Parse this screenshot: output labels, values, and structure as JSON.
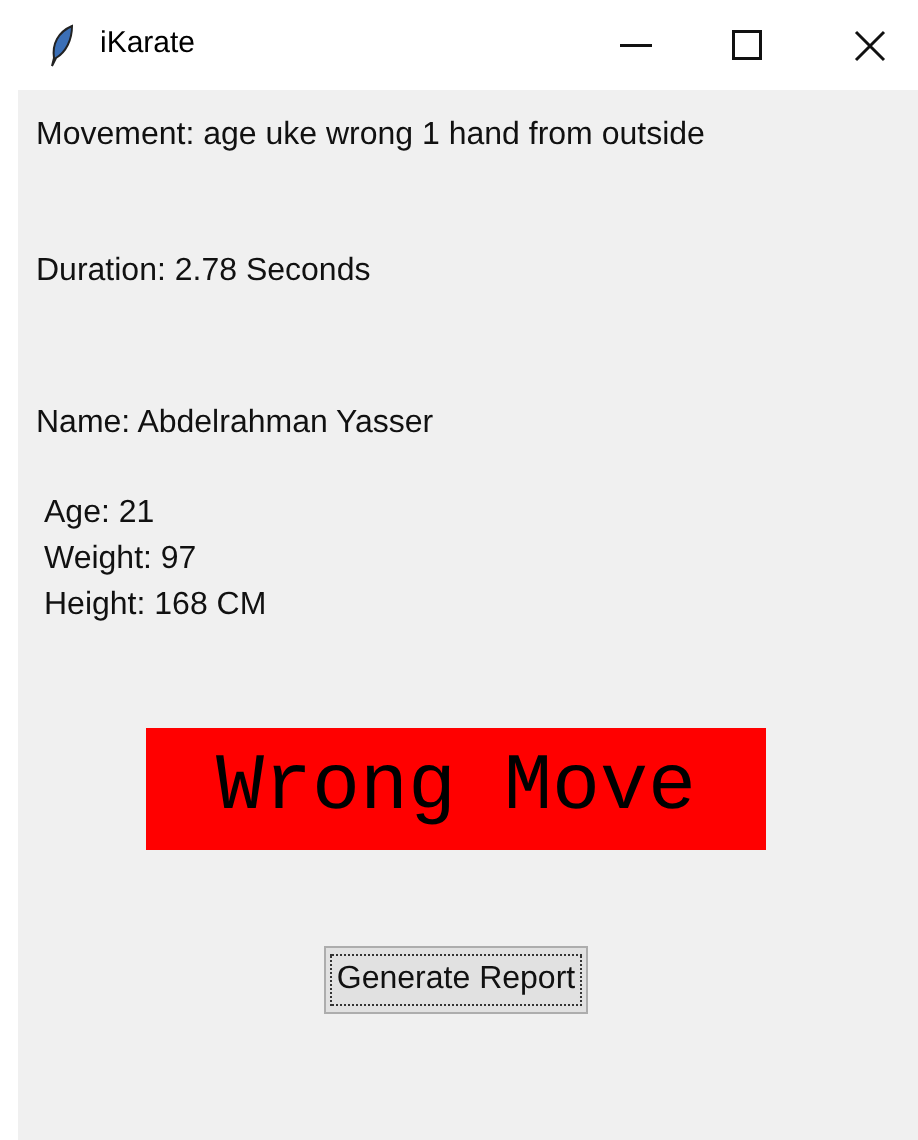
{
  "window": {
    "title": "iKarate"
  },
  "movement": "Movement: age uke wrong 1 hand from outside",
  "duration": "Duration: 2.78 Seconds",
  "name": "Name: Abdelrahman Yasser",
  "details": [
    "Age: 21",
    "Weight: 97",
    "Height: 168 CM"
  ],
  "result": {
    "text": "Wrong Move",
    "correct": false
  },
  "button": {
    "label": "Generate Report",
    "focused": true
  }
}
